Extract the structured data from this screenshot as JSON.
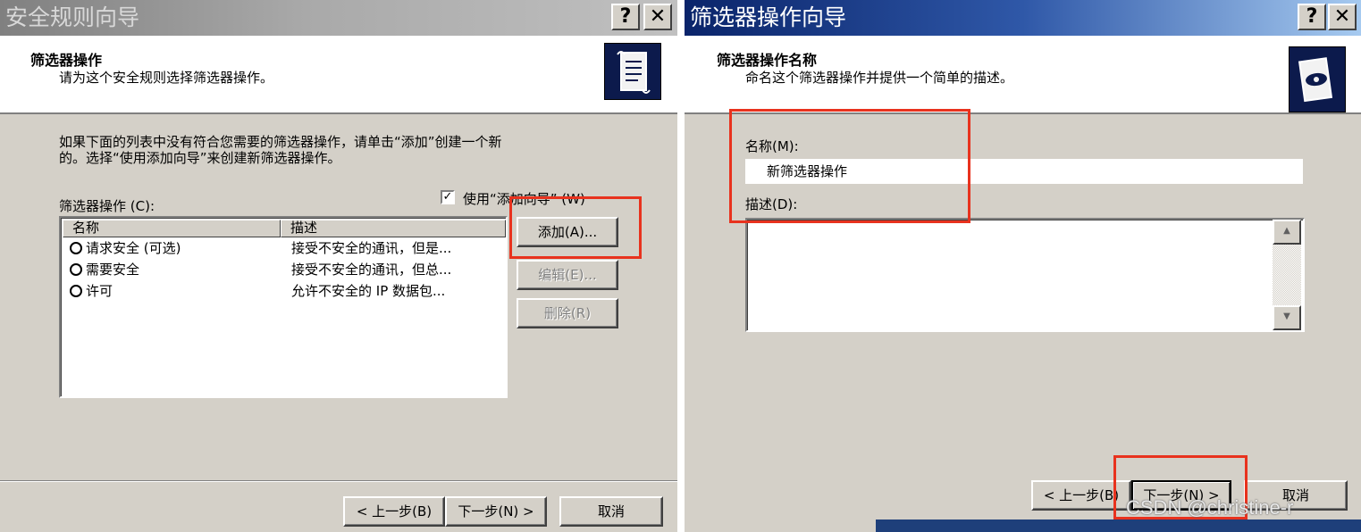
{
  "left_window": {
    "title": "安全规则向导",
    "help_btn": "?",
    "close_btn": "✕",
    "header_title": "筛选器操作",
    "header_subtitle": "请为这个安全规则选择筛选器操作。",
    "instruction_line1": "如果下面的列表中没有符合您需要的筛选器操作，请单击“添加”创建一个新",
    "instruction_line2": "的。选择“使用添加向导”来创建新筛选器操作。",
    "list_label": "筛选器操作 (C):",
    "use_wizard_checked": "✓",
    "use_wizard_label": "使用“添加向导” (W)",
    "columns": {
      "name": "名称",
      "desc": "描述"
    },
    "rows": [
      {
        "name": "请求安全 (可选)",
        "desc": "接受不安全的通讯，但是..."
      },
      {
        "name": "需要安全",
        "desc": "接受不安全的通讯，但总..."
      },
      {
        "name": "许可",
        "desc": "允许不安全的 IP 数据包..."
      }
    ],
    "add_btn": "添加(A)...",
    "edit_btn": "编辑(E)...",
    "delete_btn": "删除(R)",
    "back_btn": "< 上一步(B)",
    "next_btn": "下一步(N) >",
    "cancel_btn": "取消"
  },
  "right_window": {
    "title": "筛选器操作向导",
    "help_btn": "?",
    "close_btn": "✕",
    "header_title": "筛选器操作名称",
    "header_subtitle": "命名这个筛选器操作并提供一个简单的描述。",
    "name_label": "名称(M):",
    "name_value": "新筛选器操作",
    "desc_label": "描述(D):",
    "desc_value": "",
    "scroll_up": "▲",
    "scroll_down": "▼",
    "back_btn": "< 上一步(B)",
    "next_btn": "下一步(N) >",
    "cancel_btn": "取消"
  },
  "watermark": "CSDN @christine-r",
  "highlight_color": "#e8321e"
}
